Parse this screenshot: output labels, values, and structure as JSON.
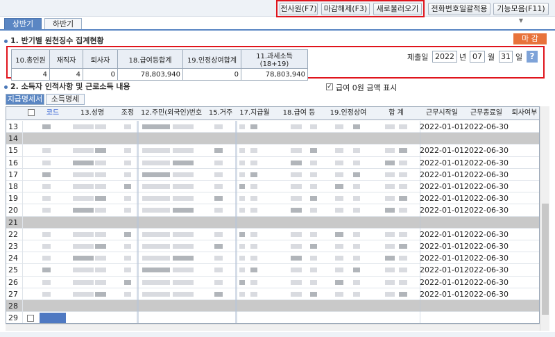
{
  "toolbar": {
    "all_employees": "전사원(F7)",
    "unlock_deadline": "마감해제(F3)",
    "reload": "새로불러오기",
    "phone_apply": "전화번호일괄적용",
    "functions": "기능모음(F11)"
  },
  "period_tabs": [
    "상반기",
    "하반기"
  ],
  "section1": {
    "title": "1. 반기별 원천징수 집계현황",
    "deadline_button": "마 감"
  },
  "summary": {
    "headers": [
      "10.총인원",
      "재직자",
      "퇴사자",
      "18.급여등합계",
      "19.인정상여합계",
      "11.과세소득(18+19)"
    ],
    "values": [
      "4",
      "4",
      "0",
      "78,803,940",
      "0",
      "78,803,940"
    ]
  },
  "filing": {
    "label": "제출일",
    "year": "2022",
    "year_unit": "년",
    "month": "07",
    "month_unit": "월",
    "day": "31",
    "day_unit": "일",
    "help": "?"
  },
  "section2": {
    "title": "2. 소득자 인적사항 및 근로소득 내용",
    "zero_salary_label": "급여 0원 금액 표시",
    "zero_salary_checked": true
  },
  "sub_tabs": [
    "지급명세서",
    "소득명세"
  ],
  "grid": {
    "headers": [
      "코드",
      "13.성명",
      "조정",
      "12.주민(외국인)번호",
      "15.거주",
      "17.지급월",
      "18.급여 등",
      "19.인정상여",
      "합 계",
      "근무시작일",
      "근무종료일",
      "퇴사여부"
    ],
    "rows": [
      {
        "num": "13",
        "start": "2022-01-01",
        "end": "2022-06-30",
        "gray": false
      },
      {
        "num": "14",
        "start": "",
        "end": "",
        "gray": true
      },
      {
        "num": "15",
        "start": "2022-01-01",
        "end": "2022-06-30",
        "gray": false
      },
      {
        "num": "16",
        "start": "2022-01-01",
        "end": "2022-06-30",
        "gray": false
      },
      {
        "num": "17",
        "start": "2022-01-01",
        "end": "2022-06-30",
        "gray": false
      },
      {
        "num": "18",
        "start": "2022-01-01",
        "end": "2022-06-30",
        "gray": false
      },
      {
        "num": "19",
        "start": "2022-01-01",
        "end": "2022-06-30",
        "gray": false
      },
      {
        "num": "20",
        "start": "2022-01-01",
        "end": "2022-06-30",
        "gray": false
      },
      {
        "num": "21",
        "start": "",
        "end": "",
        "gray": true
      },
      {
        "num": "22",
        "start": "2022-01-01",
        "end": "2022-06-30",
        "gray": false
      },
      {
        "num": "23",
        "start": "2022-01-01",
        "end": "2022-06-30",
        "gray": false
      },
      {
        "num": "24",
        "start": "2022-01-01",
        "end": "2022-06-30",
        "gray": false
      },
      {
        "num": "25",
        "start": "2022-01-01",
        "end": "2022-06-30",
        "gray": false
      },
      {
        "num": "26",
        "start": "2022-01-01",
        "end": "2022-06-30",
        "gray": false
      },
      {
        "num": "27",
        "start": "2022-01-01",
        "end": "2022-06-30",
        "gray": false
      },
      {
        "num": "28",
        "start": "",
        "end": "",
        "gray": true
      },
      {
        "num": "29",
        "start": "",
        "end": "",
        "gray": false
      }
    ]
  }
}
